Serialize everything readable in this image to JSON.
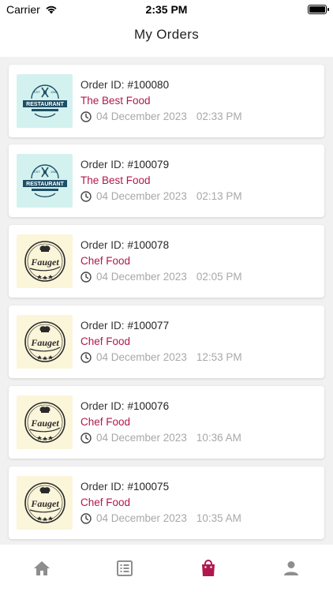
{
  "status": {
    "carrier": "Carrier",
    "time": "2:35 PM"
  },
  "header": {
    "title": "My Orders"
  },
  "order_id_label": "Order ID:",
  "orders": [
    {
      "id": "#100080",
      "shop": "The Best Food",
      "date": "04 December 2023",
      "time": "02:33 PM",
      "logo": "restaurant"
    },
    {
      "id": "#100079",
      "shop": "The Best Food",
      "date": "04 December 2023",
      "time": "02:13 PM",
      "logo": "restaurant"
    },
    {
      "id": "#100078",
      "shop": "Chef Food",
      "date": "04 December 2023",
      "time": "02:05 PM",
      "logo": "fauget"
    },
    {
      "id": "#100077",
      "shop": "Chef Food",
      "date": "04 December 2023",
      "time": "12:53 PM",
      "logo": "fauget"
    },
    {
      "id": "#100076",
      "shop": "Chef Food",
      "date": "04 December 2023",
      "time": "10:36 AM",
      "logo": "fauget"
    },
    {
      "id": "#100075",
      "shop": "Chef Food",
      "date": "04 December 2023",
      "time": "10:35 AM",
      "logo": "fauget"
    }
  ],
  "logos": {
    "restaurant": {
      "text": "RESTAURANT",
      "est": "EST",
      "year": "1985"
    },
    "fauget": {
      "text": "Fauget"
    }
  },
  "tabs": [
    {
      "icon": "home-icon",
      "active": false
    },
    {
      "icon": "list-icon",
      "active": false
    },
    {
      "icon": "shopping-bag-icon",
      "active": true
    },
    {
      "icon": "profile-icon",
      "active": false
    }
  ],
  "colors": {
    "accent": "#b0174d",
    "inactive_tab": "#8e8e8e",
    "muted_text": "#a8a8a8"
  }
}
